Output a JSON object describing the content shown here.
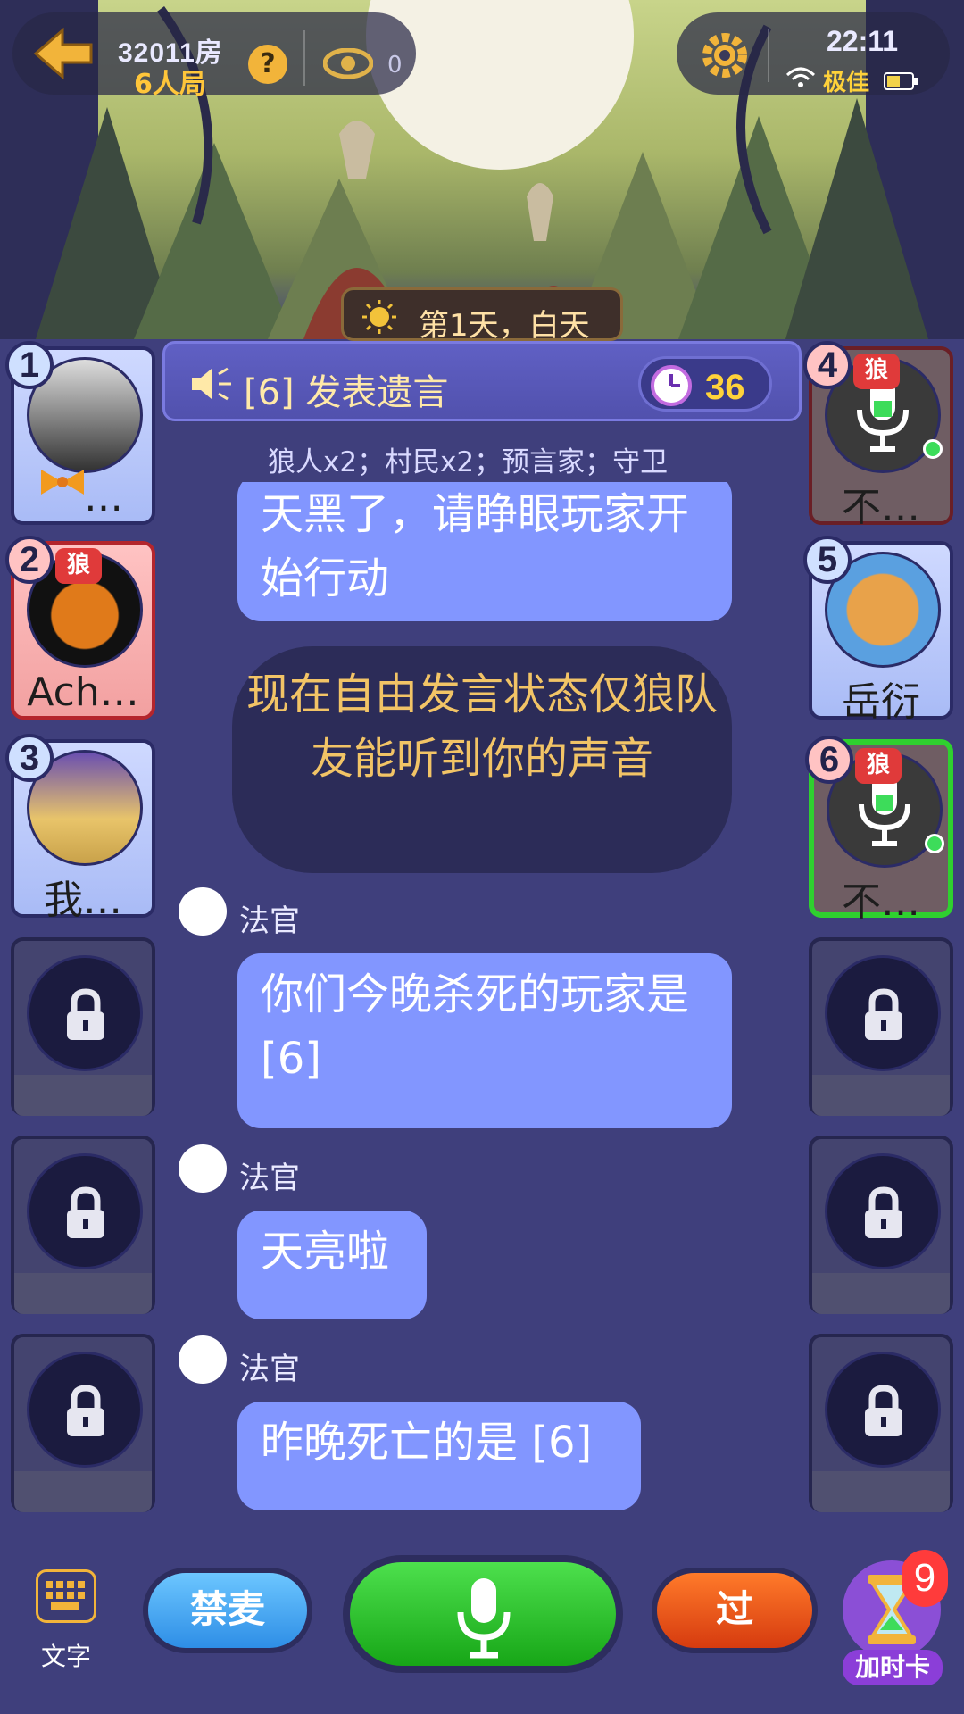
{
  "header": {
    "room_number": "32011房",
    "room_mode": "6人局",
    "help_label": "?",
    "viewer_count": "0",
    "time": "22:11",
    "network_quality": "极佳"
  },
  "phase": {
    "day_label": "第1天，白天"
  },
  "speech": {
    "text": "[6] 发表遗言",
    "timer": "36"
  },
  "roles_text": "狼人x2；村民x2；预言家；守卫",
  "seats": [
    {
      "num": "1",
      "name": "…",
      "state": "alive"
    },
    {
      "num": "2",
      "name": "Ach…",
      "tag": "狼",
      "state": "alive"
    },
    {
      "num": "3",
      "name": "我…",
      "state": "alive"
    },
    {
      "num": "4",
      "name": "不…",
      "tag": "狼",
      "state": "dead"
    },
    {
      "num": "5",
      "name": "岳衍",
      "state": "alive"
    },
    {
      "num": "6",
      "name": "不…",
      "tag": "狼",
      "state": "dead-speaking"
    }
  ],
  "chat": {
    "msg1": "天黑了，请睁眼玩家开始行动",
    "system": "现在自由发言状态仅狼队友能听到你的声音",
    "judge_name": "法官",
    "msg2": "你们今晚杀死的玩家是 [6]",
    "msg3": "天亮啦",
    "msg4": "昨晚死亡的是 [6]"
  },
  "bottom": {
    "keyboard_label": "文字",
    "mute_label": "禁麦",
    "pass_label": "过",
    "time_card_label": "加时卡",
    "time_card_count": "9"
  },
  "colors": {
    "bubble": "#8296ff",
    "background": "#3f3f7c",
    "wolf_tag": "#e03a3a",
    "active_border": "#2fd02f"
  },
  "icons": [
    "back-arrow-icon",
    "help-icon",
    "eye-icon",
    "gear-icon",
    "wifi-icon",
    "battery-icon",
    "sun-icon",
    "speaker-icon",
    "clock-icon",
    "mic-icon",
    "lock-icon",
    "keyboard-icon",
    "hourglass-icon"
  ]
}
